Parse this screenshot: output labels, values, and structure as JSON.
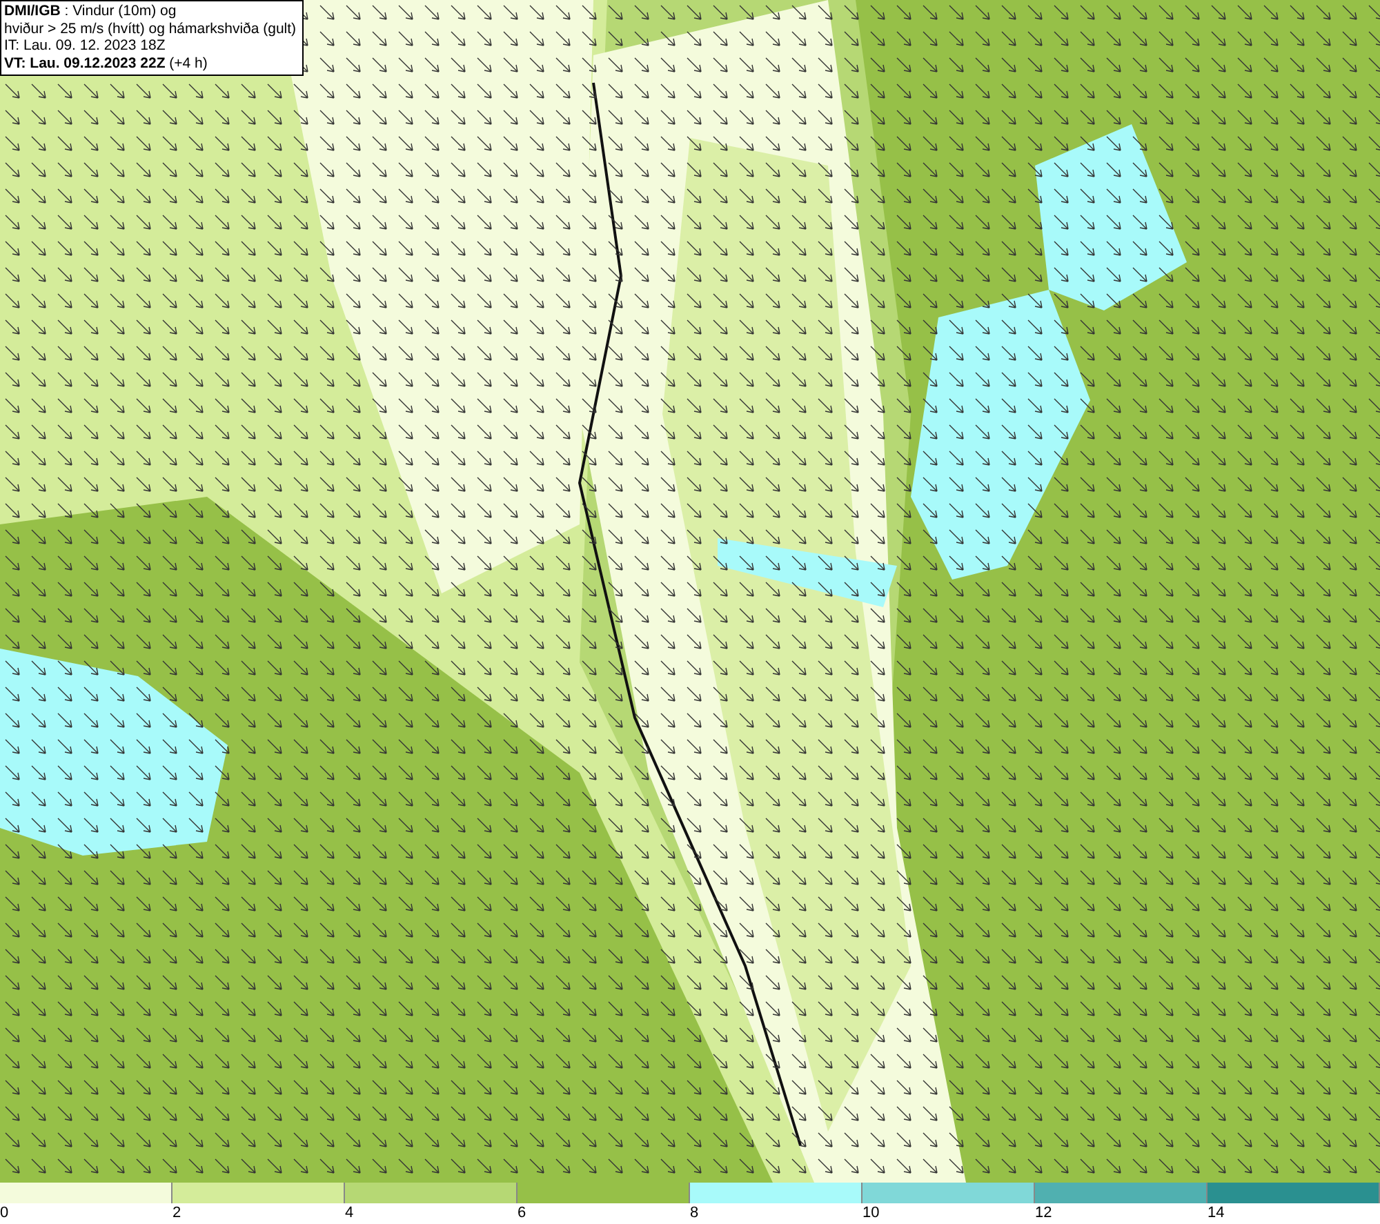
{
  "header": {
    "lines": [
      "**DMI/IGB** : Vindur (10m) og",
      "hviður > 25 m/s (hvítt) og hámarkshviða (gult)",
      "IT: Lau. 09. 12. 2023 18Z",
      "**VT: Lau. 09.12.2023 22Z** (+4 h)"
    ]
  },
  "legend": [
    {
      "color": "#f4fbdc",
      "label": "0"
    },
    {
      "color": "#d4ec9a",
      "label": "2"
    },
    {
      "color": "#b6d874",
      "label": "4"
    },
    {
      "color": "#96c048",
      "label": "6"
    },
    {
      "color": "#a8fafa",
      "label": "8"
    },
    {
      "color": "#80d8d8",
      "label": "10"
    },
    {
      "color": "#50b0b0",
      "label": "12"
    },
    {
      "color": "#2a9090",
      "label": "14"
    }
  ]
}
